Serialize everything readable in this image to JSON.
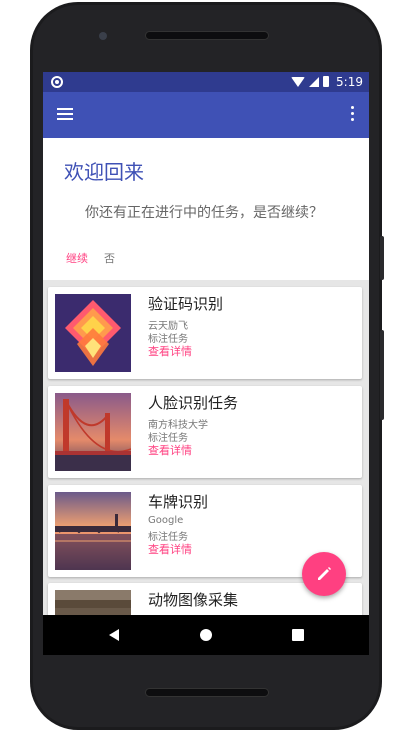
{
  "status_bar": {
    "time": "5:19"
  },
  "welcome": {
    "title": "欢迎回来",
    "message": "你还有正在进行中的任务，是否继续？",
    "continue_label": "继续",
    "no_label": "否"
  },
  "tasks": [
    {
      "name": "验证码识别",
      "owner": "云天励飞",
      "type": "标注任务",
      "details": "查看详情"
    },
    {
      "name": "人脸识别任务",
      "owner": "南方科技大学",
      "type": "标注任务",
      "details": "查看详情"
    },
    {
      "name": "车牌识别",
      "owner": "Google",
      "type": "标注任务",
      "details": "查看详情"
    },
    {
      "name": "动物图像采集",
      "owner": "",
      "type": "",
      "details": ""
    }
  ],
  "colors": {
    "primary": "#3f51b5",
    "primary_dark": "#2f3b8f",
    "accent": "#ff4081"
  },
  "icons": {
    "menu": "hamburger-menu-icon",
    "more": "overflow-menu-icon",
    "fab": "pencil-icon",
    "back": "back-triangle-icon",
    "home": "home-circle-icon",
    "recents": "recents-square-icon"
  }
}
